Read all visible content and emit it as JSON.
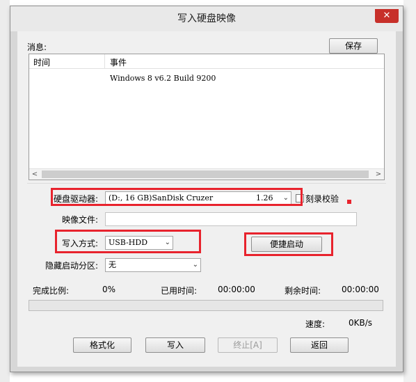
{
  "window": {
    "title": "写入硬盘映像",
    "close_icon": "close-icon"
  },
  "messages": {
    "label": "消息:",
    "save_label": "保存",
    "columns": [
      "时间",
      "事件"
    ],
    "rows": [
      {
        "time": "",
        "event": "Windows 8 v6.2 Build 9200"
      }
    ]
  },
  "drive": {
    "label": "硬盘驱动器:",
    "value": "(D:, 16 GB)SanDisk Cruzer",
    "version": "1.26",
    "verify_label": "刻录校验"
  },
  "image_file": {
    "label": "映像文件:",
    "value": ""
  },
  "write_mode": {
    "label": "写入方式:",
    "value": "USB-HDD"
  },
  "quick_boot": {
    "label": "便捷启动"
  },
  "hidden_partition": {
    "label": "隐藏启动分区:",
    "value": "无"
  },
  "progress": {
    "complete_label": "完成比例:",
    "complete_value": "0%",
    "elapsed_label": "已用时间:",
    "elapsed_value": "00:00:00",
    "remaining_label": "剩余时间:",
    "remaining_value": "00:00:00",
    "speed_label": "速度:",
    "speed_value": "0KB/s"
  },
  "actions": {
    "format_label": "格式化",
    "write_label": "写入",
    "abort_label": "终止[A]",
    "back_label": "返回"
  },
  "colors": {
    "highlight": "#e8232d",
    "close": "#c7302a"
  }
}
